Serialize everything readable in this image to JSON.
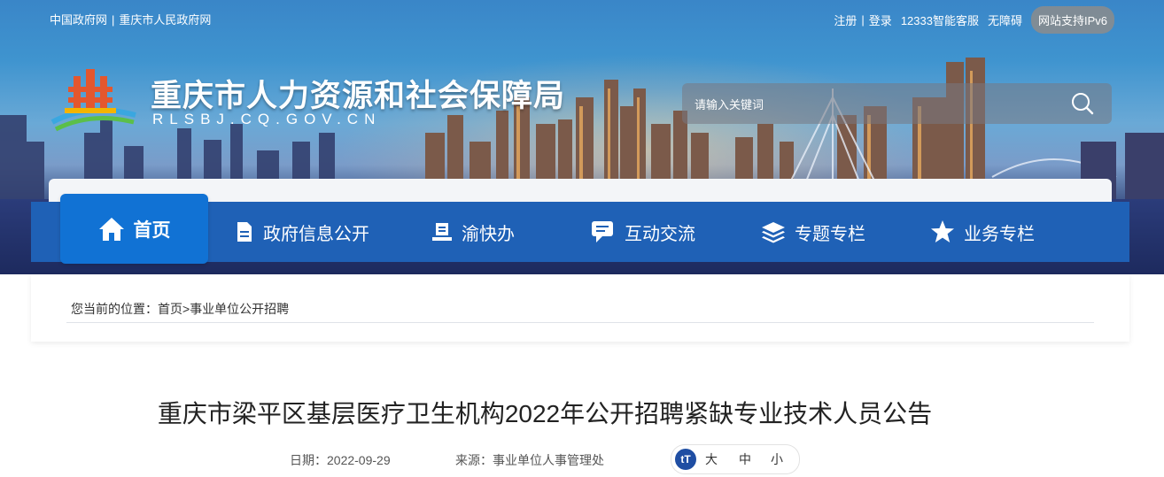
{
  "top_links": {
    "left": [
      "中国政府网",
      "重庆市人民政府网"
    ],
    "register": "注册",
    "login": "登录",
    "service": "12333智能客服",
    "accessibility": "无障碍",
    "ipv6": "网站支持IPv6"
  },
  "site": {
    "title": "重庆市人力资源和社会保障局",
    "domain": "RLSBJ.CQ.GOV.CN"
  },
  "search": {
    "placeholder": "请输入关键词"
  },
  "nav": {
    "items": [
      {
        "label": "首页",
        "icon": "home-icon"
      },
      {
        "label": "政府信息公开",
        "icon": "document-icon"
      },
      {
        "label": "渝快办",
        "icon": "desk-icon"
      },
      {
        "label": "互动交流",
        "icon": "chat-icon"
      },
      {
        "label": "专题专栏",
        "icon": "layers-icon"
      },
      {
        "label": "业务专栏",
        "icon": "star-icon"
      }
    ]
  },
  "breadcrumb": {
    "prefix": "您当前的位置：",
    "home": "首页",
    "sep": ">",
    "current": "事业单位公开招聘"
  },
  "article": {
    "title": "重庆市梁平区基层医疗卫生机构2022年公开招聘紧缺专业技术人员公告",
    "date_label": "日期：",
    "date": "2022-09-29",
    "source_label": "来源：",
    "source": "事业单位人事管理处",
    "font_icon": "tT",
    "font_large": "大",
    "font_medium": "中",
    "font_small": "小"
  },
  "colors": {
    "nav_bg": "#1f61b6",
    "nav_active": "#1172d4",
    "title_text": "#222222"
  }
}
